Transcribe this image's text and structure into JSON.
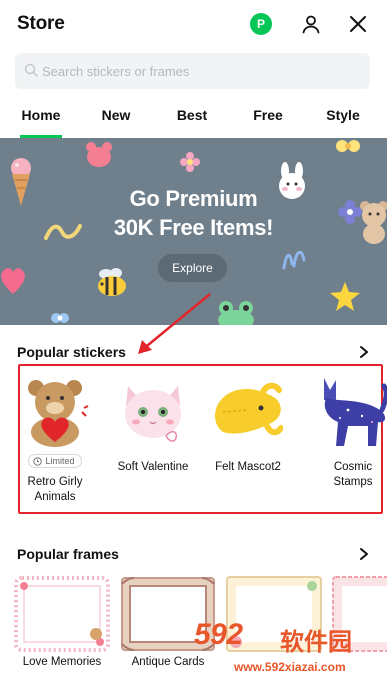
{
  "header": {
    "title": "Store",
    "premium_badge": "P",
    "icons": [
      "profile-icon",
      "close-icon"
    ]
  },
  "search": {
    "placeholder": "Search stickers or frames"
  },
  "tabs": [
    {
      "label": "Home",
      "selected": true
    },
    {
      "label": "New",
      "selected": false
    },
    {
      "label": "Best",
      "selected": false
    },
    {
      "label": "Free",
      "selected": false
    },
    {
      "label": "Style",
      "selected": false
    }
  ],
  "banner": {
    "line1": "Go Premium",
    "line2": "30K Free Items!",
    "button": "Explore"
  },
  "popular_stickers": {
    "title": "Popular stickers",
    "items": [
      {
        "name": "Retro Girly Animals",
        "badge": "Limited"
      },
      {
        "name": "Soft Valentine"
      },
      {
        "name": "Felt Mascot2"
      },
      {
        "name": "Cosmic Stamps"
      }
    ]
  },
  "popular_frames": {
    "title": "Popular frames",
    "items": [
      {
        "name": "Love Memories"
      },
      {
        "name": "Antique Cards"
      },
      {
        "name": ""
      },
      {
        "name": ""
      }
    ]
  },
  "watermark": {
    "brand": "592",
    "chinese": "软件园",
    "url": "www.592xiazai.com"
  },
  "colors": {
    "accent_green": "#06c755",
    "banner_bg": "#6f7f8c",
    "highlight_red": "#e2252b",
    "watermark_orange": "#e8562a"
  }
}
